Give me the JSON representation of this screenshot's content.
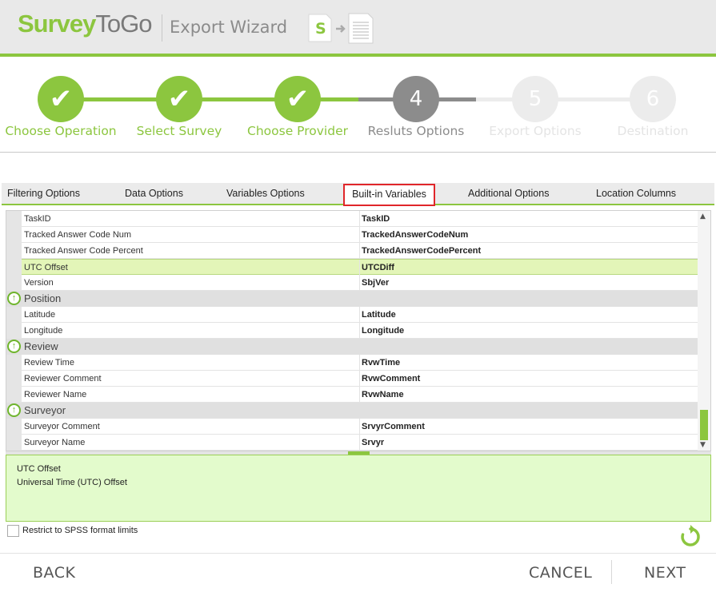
{
  "header": {
    "logo_part1": "Survey",
    "logo_part2": "ToGo",
    "title": "Export Wizard",
    "icon": "spss-to-document-icon",
    "icon_letter": "S"
  },
  "steps": [
    {
      "label": "Choose Operation",
      "state": "done",
      "mark": "✔"
    },
    {
      "label": "Select Survey",
      "state": "done",
      "mark": "✔"
    },
    {
      "label": "Choose Provider",
      "state": "done",
      "mark": "✔"
    },
    {
      "label": "Resluts Options",
      "state": "active",
      "mark": "4"
    },
    {
      "label": "Export Options",
      "state": "todo",
      "mark": "5"
    },
    {
      "label": "Destination",
      "state": "todo",
      "mark": "6"
    }
  ],
  "tabs": [
    {
      "label": "Filtering Options"
    },
    {
      "label": "Data Options"
    },
    {
      "label": "Variables Options"
    },
    {
      "label": "Built-in Variables",
      "selected": true
    },
    {
      "label": "Additional Options"
    },
    {
      "label": "Location Columns"
    }
  ],
  "grid": {
    "rows": [
      {
        "type": "row",
        "name": "TaskID",
        "value": "TaskID"
      },
      {
        "type": "row",
        "name": "Tracked Answer Code Num",
        "value": "TrackedAnswerCodeNum"
      },
      {
        "type": "row",
        "name": "Tracked Answer Code Percent",
        "value": "TrackedAnswerCodePercent"
      },
      {
        "type": "row",
        "name": "UTC Offset",
        "value": "UTCDiff",
        "highlighted": true
      },
      {
        "type": "row",
        "name": "Version",
        "value": "SbjVer"
      },
      {
        "type": "group",
        "name": "Position"
      },
      {
        "type": "row",
        "name": "Latitude",
        "value": "Latitude"
      },
      {
        "type": "row",
        "name": "Longitude",
        "value": "Longitude"
      },
      {
        "type": "group",
        "name": "Review"
      },
      {
        "type": "row",
        "name": "Review Time",
        "value": "RvwTime"
      },
      {
        "type": "row",
        "name": "Reviewer Comment",
        "value": "RvwComment"
      },
      {
        "type": "row",
        "name": "Reviewer Name",
        "value": "RvwName"
      },
      {
        "type": "group",
        "name": "Surveyor"
      },
      {
        "type": "row",
        "name": "Surveyor Comment",
        "value": "SrvyrComment"
      },
      {
        "type": "row",
        "name": "Surveyor Name",
        "value": "Srvyr"
      }
    ],
    "group_icon": "collapse-up-arrow-icon"
  },
  "description": {
    "title": "UTC Offset",
    "text": "Universal Time (UTC) Offset"
  },
  "options": {
    "restrict_spss_label": "Restrict to SPSS format limits",
    "restrict_spss_checked": false
  },
  "footer": {
    "back": "BACK",
    "cancel": "CANCEL",
    "next": "NEXT"
  },
  "colors": {
    "accent": "#8cc63f",
    "active_step": "#8c8c8c",
    "selected_tab_border": "#e0262a",
    "highlight_row": "#e3f5b8",
    "description_bg": "#e3fbcc"
  }
}
